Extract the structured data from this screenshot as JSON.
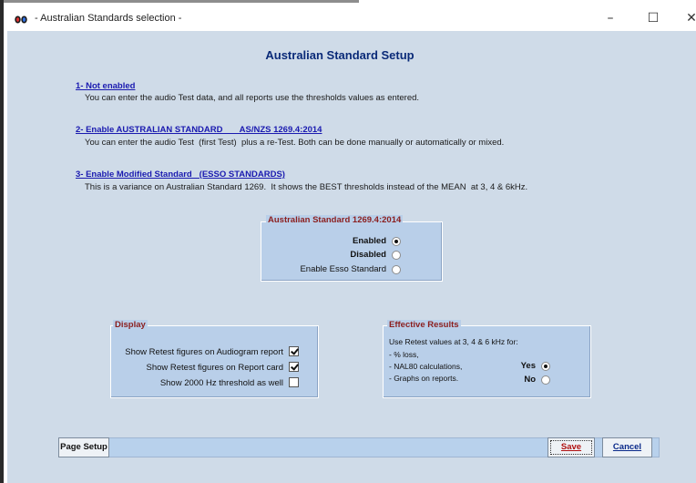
{
  "window": {
    "title": "- Australian Standards selection -",
    "controls": {
      "minimize": "–",
      "maximize": "☐",
      "close": "✕"
    }
  },
  "main": {
    "title": "Australian Standard Setup",
    "options": [
      {
        "heading": "1- Not enabled",
        "description": "You can enter the audio Test data, and all reports use the thresholds values as entered."
      },
      {
        "heading": "2- Enable AUSTRALIAN STANDARD       AS/NZS 1269.4:2014",
        "description": "You can enter the audio Test  (first Test)  plus a re-Test. Both can be done manually or automatically or mixed."
      },
      {
        "heading": "3- Enable Modified Standard   (ESSO STANDARDS)",
        "description": "This is a variance on Australian Standard 1269.  It shows the BEST thresholds instead of the MEAN  at 3, 4 & 6kHz."
      }
    ]
  },
  "standard_group": {
    "title": "Australian Standard 1269.4:2014",
    "items": [
      {
        "label": "Enabled",
        "selected": true
      },
      {
        "label": "Disabled",
        "selected": false
      },
      {
        "label": "Enable Esso Standard",
        "selected": false
      }
    ]
  },
  "display_group": {
    "title": "Display",
    "items": [
      {
        "label": "Show Retest figures on Audiogram report",
        "checked": true
      },
      {
        "label": "Show Retest figures on Report card",
        "checked": true
      },
      {
        "label": "Show 2000 Hz threshold as well",
        "checked": false
      }
    ]
  },
  "effective_group": {
    "title": "Effective Results",
    "lines": [
      "Use Retest values at 3, 4 & 6 kHz for:",
      "- % loss,",
      "- NAL80 calculations,",
      "- Graphs on reports."
    ],
    "yes_label": "Yes",
    "no_label": "No",
    "yes_selected": true
  },
  "toolbar": {
    "page_setup": "Page Setup",
    "save": "Save",
    "cancel": "Cancel"
  },
  "colors": {
    "background": "#cfdbe8",
    "groupbox": "#b9cfe9",
    "heading_link": "#1a1ab0",
    "group_title": "#8b1e1e"
  }
}
